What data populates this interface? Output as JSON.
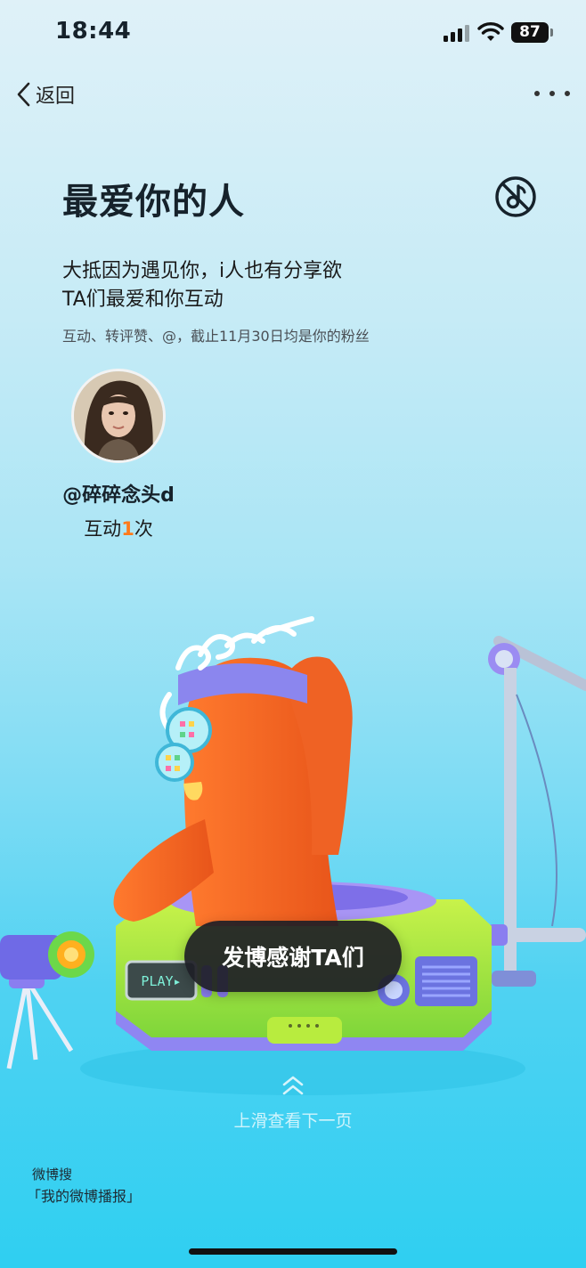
{
  "status_bar": {
    "time": "18:44",
    "battery": "87"
  },
  "nav": {
    "back_label": "返回"
  },
  "header": {
    "title": "最爱你的人",
    "line1": "大抵因为遇见你，i人也有分享欲",
    "line2": "TA们最爱和你互动",
    "caption": "互动、转评赞、@，截止11月30日均是你的粉丝"
  },
  "user": {
    "username": "@碎碎念头d",
    "count_prefix": "互动",
    "count_value": "1",
    "count_suffix": "次"
  },
  "illustration": {
    "screen_text": "PLAY▸"
  },
  "cta": {
    "label": "发博感谢TA们"
  },
  "swipe_hint": "上滑查看下一页",
  "brand": {
    "line1": "微博搜",
    "line2": "「我的微博播报」"
  },
  "icons": [
    "chevron-left-icon",
    "more-icon",
    "music-off-icon",
    "chevron-up-icon",
    "signal-icon",
    "wifi-icon",
    "battery-icon"
  ],
  "colors": {
    "accent_orange": "#ff7a1a",
    "cta_bg": "#1e1e26"
  }
}
